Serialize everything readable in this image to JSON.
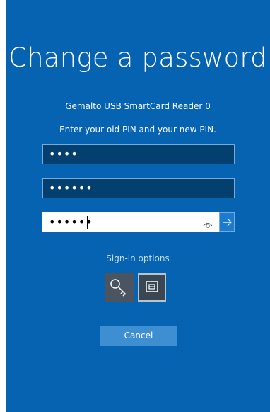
{
  "dialog": {
    "title": "Change a password",
    "reader_name": "Gemalto USB SmartCard Reader 0",
    "prompt": "Enter your old PIN and your new PIN."
  },
  "fields": {
    "old_pin": {
      "value": "••••"
    },
    "new_pin": {
      "value": "••••••"
    },
    "confirm_pin": {
      "value": "••••••"
    }
  },
  "icons": {
    "reveal": "eye-icon",
    "submit": "arrow-right-icon",
    "key": "key-icon",
    "smartcard": "smartcard-icon"
  },
  "sign_in_options": {
    "label": "Sign-in options"
  },
  "actions": {
    "cancel_label": "Cancel"
  },
  "colors": {
    "background": "#0563b1",
    "field_dark": "#04406f",
    "button": "#3e8fd1"
  }
}
